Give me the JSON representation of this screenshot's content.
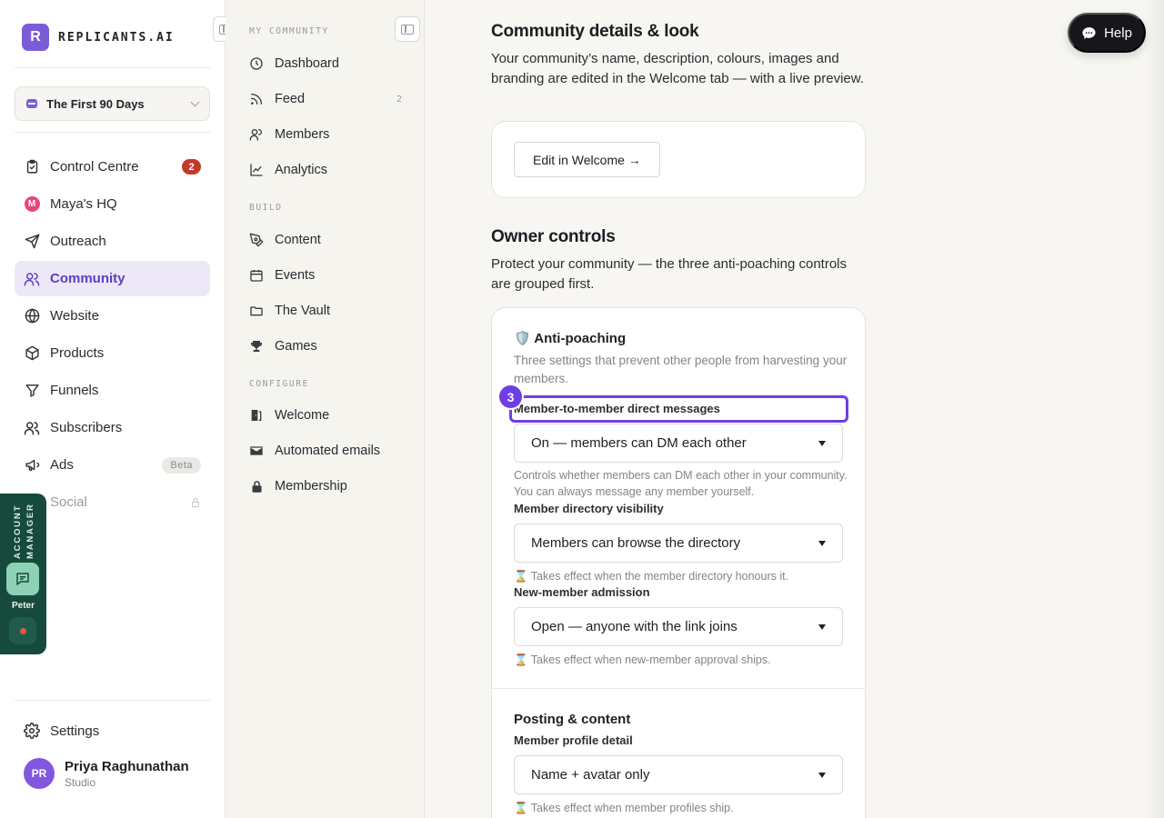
{
  "brand": {
    "logo_letter": "R",
    "name": "REPLICANTS.AI"
  },
  "workspace": {
    "name": "The First 90 Days"
  },
  "nav": [
    {
      "label": "Control Centre",
      "badge": "2"
    },
    {
      "label": "Maya's HQ",
      "icon_letter": "M"
    },
    {
      "label": "Outreach"
    },
    {
      "label": "Community"
    },
    {
      "label": "Website"
    },
    {
      "label": "Products"
    },
    {
      "label": "Funnels"
    },
    {
      "label": "Subscribers"
    },
    {
      "label": "Ads",
      "badge": "Beta"
    },
    {
      "label": "Social"
    }
  ],
  "settings": {
    "label": "Settings"
  },
  "user": {
    "initials": "PR",
    "name": "Priya Raghunathan",
    "plan": "Studio"
  },
  "account_manager": {
    "label": "ACCOUNT MANAGER",
    "name": "Peter"
  },
  "subnav": {
    "sections": {
      "my_community": "MY COMMUNITY",
      "build": "BUILD",
      "configure": "CONFIGURE"
    },
    "items": {
      "dashboard": "Dashboard",
      "feed": "Feed",
      "feed_count": "2",
      "members": "Members",
      "analytics": "Analytics",
      "content": "Content",
      "events": "Events",
      "vault": "The Vault",
      "games": "Games",
      "welcome": "Welcome",
      "automated_emails": "Automated emails",
      "membership": "Membership"
    }
  },
  "main": {
    "details": {
      "title": "Community details & look",
      "description": "Your community’s name, description, colours, images and branding are edited in the Welcome tab — with a live preview.",
      "edit_button": "Edit in Welcome →"
    },
    "owner": {
      "title": "Owner controls",
      "description": "Protect your community — the three anti-poaching controls are grouped first."
    },
    "anti_poaching": {
      "title": "🛡️ Anti-poaching",
      "subtitle": "Three settings that prevent other people from harvesting your members.",
      "step": "3",
      "dm": {
        "label": "Member-to-member direct messages",
        "value": "On — members can DM each other",
        "help": "Controls whether members can DM each other in your community. You can always message any member yourself."
      },
      "directory": {
        "label": "Member directory visibility",
        "value": "Members can browse the directory",
        "help": "⌛ Takes effect when the member directory honours it."
      },
      "admission": {
        "label": "New-member admission",
        "value": "Open — anyone with the link joins",
        "help": "⌛ Takes effect when new-member approval ships."
      }
    },
    "posting": {
      "title": "Posting & content",
      "profile": {
        "label": "Member profile detail",
        "value": "Name + avatar only",
        "help": "⌛ Takes effect when member profiles ship."
      }
    }
  },
  "help_button": {
    "label": "Help"
  },
  "colors": {
    "accent": "#6d3fe3",
    "brand": "#7c5cd6",
    "danger": "#c0392b",
    "manager_bg": "#164a3c"
  }
}
